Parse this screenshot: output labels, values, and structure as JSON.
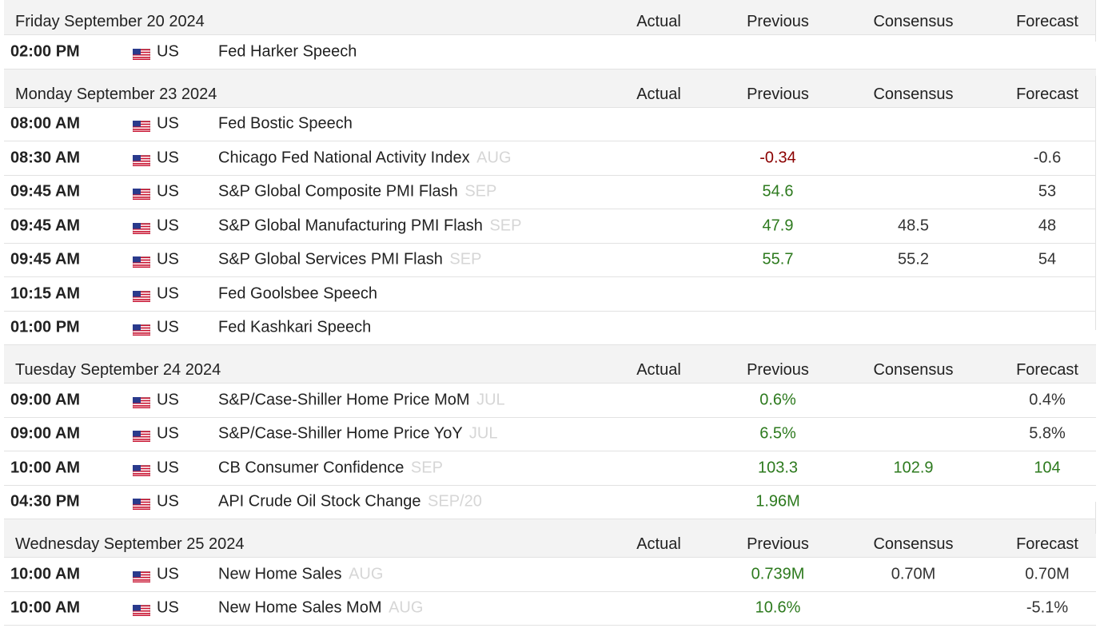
{
  "columns": {
    "actual": "Actual",
    "previous": "Previous",
    "consensus": "Consensus",
    "forecast": "Forecast"
  },
  "colors": {
    "positive": "#2d7a1e",
    "negative": "#8b0000",
    "header_bg": "#f3f3f3",
    "reference": "#d6d6d6"
  },
  "flag_icon": "us-flag-icon",
  "days": [
    {
      "date": "Friday September 20 2024",
      "events": [
        {
          "time": "02:00 PM",
          "country": "US",
          "event": "Fed Harker Speech",
          "ref": "",
          "actual": "",
          "previous": "",
          "consensus": "",
          "forecast": "",
          "prev_tone": "def",
          "cons_tone": "def",
          "fore_tone": "def"
        }
      ]
    },
    {
      "date": "Monday September 23 2024",
      "events": [
        {
          "time": "08:00 AM",
          "country": "US",
          "event": "Fed Bostic Speech",
          "ref": "",
          "actual": "",
          "previous": "",
          "consensus": "",
          "forecast": "",
          "prev_tone": "def",
          "cons_tone": "def",
          "fore_tone": "def"
        },
        {
          "time": "08:30 AM",
          "country": "US",
          "event": "Chicago Fed National Activity Index",
          "ref": "AUG",
          "actual": "",
          "previous": "-0.34",
          "consensus": "",
          "forecast": "-0.6",
          "prev_tone": "neg",
          "cons_tone": "def",
          "fore_tone": "def"
        },
        {
          "time": "09:45 AM",
          "country": "US",
          "event": "S&P Global Composite PMI Flash",
          "ref": "SEP",
          "actual": "",
          "previous": "54.6",
          "consensus": "",
          "forecast": "53",
          "prev_tone": "pos",
          "cons_tone": "def",
          "fore_tone": "def"
        },
        {
          "time": "09:45 AM",
          "country": "US",
          "event": "S&P Global Manufacturing PMI Flash",
          "ref": "SEP",
          "actual": "",
          "previous": "47.9",
          "consensus": "48.5",
          "forecast": "48",
          "prev_tone": "pos",
          "cons_tone": "def",
          "fore_tone": "def"
        },
        {
          "time": "09:45 AM",
          "country": "US",
          "event": "S&P Global Services PMI Flash",
          "ref": "SEP",
          "actual": "",
          "previous": "55.7",
          "consensus": "55.2",
          "forecast": "54",
          "prev_tone": "pos",
          "cons_tone": "def",
          "fore_tone": "def"
        },
        {
          "time": "10:15 AM",
          "country": "US",
          "event": "Fed Goolsbee Speech",
          "ref": "",
          "actual": "",
          "previous": "",
          "consensus": "",
          "forecast": "",
          "prev_tone": "def",
          "cons_tone": "def",
          "fore_tone": "def"
        },
        {
          "time": "01:00 PM",
          "country": "US",
          "event": "Fed Kashkari Speech",
          "ref": "",
          "actual": "",
          "previous": "",
          "consensus": "",
          "forecast": "",
          "prev_tone": "def",
          "cons_tone": "def",
          "fore_tone": "def"
        }
      ]
    },
    {
      "date": "Tuesday September 24 2024",
      "events": [
        {
          "time": "09:00 AM",
          "country": "US",
          "event": "S&P/Case-Shiller Home Price MoM",
          "ref": "JUL",
          "actual": "",
          "previous": "0.6%",
          "consensus": "",
          "forecast": "0.4%",
          "prev_tone": "pos",
          "cons_tone": "def",
          "fore_tone": "def"
        },
        {
          "time": "09:00 AM",
          "country": "US",
          "event": "S&P/Case-Shiller Home Price YoY",
          "ref": "JUL",
          "actual": "",
          "previous": "6.5%",
          "consensus": "",
          "forecast": "5.8%",
          "prev_tone": "pos",
          "cons_tone": "def",
          "fore_tone": "def"
        },
        {
          "time": "10:00 AM",
          "country": "US",
          "event": "CB Consumer Confidence",
          "ref": "SEP",
          "actual": "",
          "previous": "103.3",
          "consensus": "102.9",
          "forecast": "104",
          "prev_tone": "pos",
          "cons_tone": "pos",
          "fore_tone": "pos"
        },
        {
          "time": "04:30 PM",
          "country": "US",
          "event": "API Crude Oil Stock Change",
          "ref": "SEP/20",
          "actual": "",
          "previous": "1.96M",
          "consensus": "",
          "forecast": "",
          "prev_tone": "pos",
          "cons_tone": "def",
          "fore_tone": "def"
        }
      ]
    },
    {
      "date": "Wednesday September 25 2024",
      "events": [
        {
          "time": "10:00 AM",
          "country": "US",
          "event": "New Home Sales",
          "ref": "AUG",
          "actual": "",
          "previous": "0.739M",
          "consensus": "0.70M",
          "forecast": "0.70M",
          "prev_tone": "pos",
          "cons_tone": "def",
          "fore_tone": "def"
        },
        {
          "time": "10:00 AM",
          "country": "US",
          "event": "New Home Sales MoM",
          "ref": "AUG",
          "actual": "",
          "previous": "10.6%",
          "consensus": "",
          "forecast": "-5.1%",
          "prev_tone": "pos",
          "cons_tone": "def",
          "fore_tone": "def"
        }
      ]
    }
  ]
}
